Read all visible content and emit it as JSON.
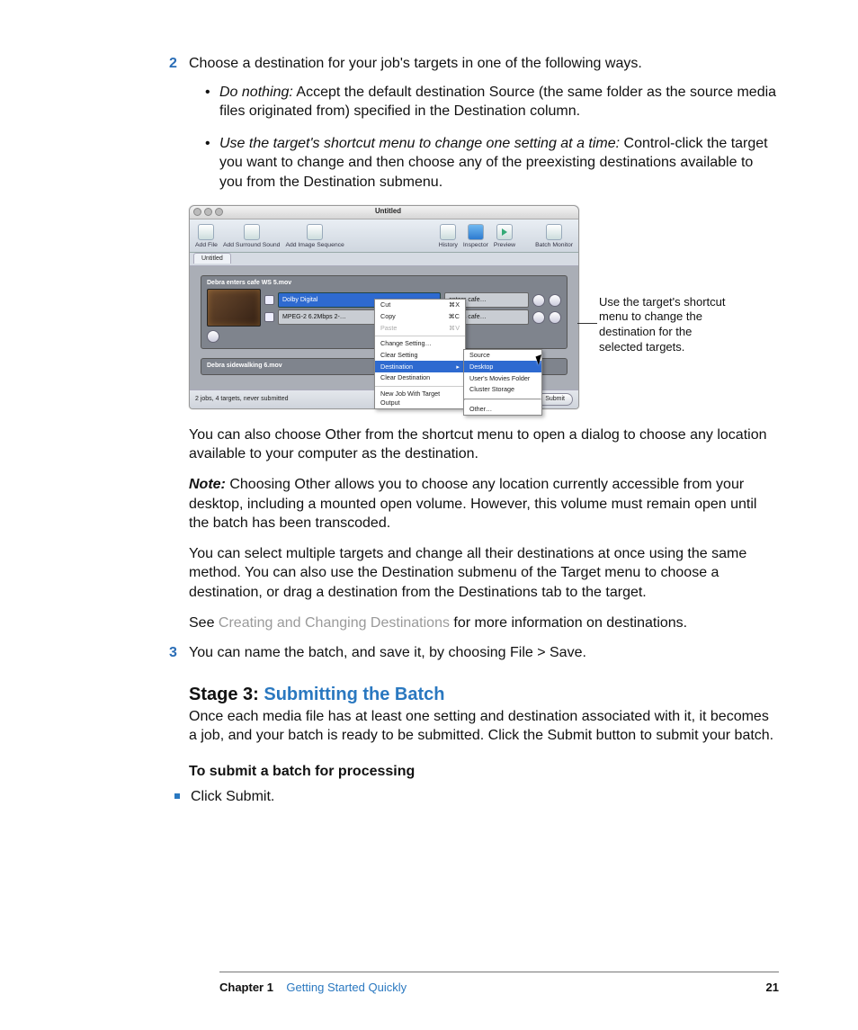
{
  "step2": {
    "num": "2",
    "text": "Choose a destination for your job's targets in one of the following ways.",
    "bullets": [
      {
        "lead": "Do nothing:",
        "rest": "  Accept the default destination Source (the same folder as the source media files originated from) specified in the Destination column."
      },
      {
        "lead": "Use the target's shortcut menu to change one setting at a time:",
        "rest": "  Control-click the target you want to change and then choose any of the preexisting destinations available to you from the Destination submenu."
      }
    ]
  },
  "screenshot": {
    "title": "Untitled",
    "toolbar": {
      "add_file": "Add File",
      "add_surround": "Add Surround Sound",
      "add_image_seq": "Add Image Sequence",
      "history": "History",
      "inspector": "Inspector",
      "preview": "Preview",
      "batch_monitor": "Batch Monitor"
    },
    "tab": "Untitled",
    "job1": {
      "title": "Debra enters cafe WS 5.mov",
      "row1_setting": "Dolby Digital",
      "row1_dest": "enters cafe…",
      "row2_setting": "MPEG-2 6.2Mbps 2-…",
      "row2_dest": "enters cafe…"
    },
    "job2": {
      "title": "Debra sidewalking 6.mov"
    },
    "menu": {
      "cut": "Cut",
      "cut_k": "⌘X",
      "copy": "Copy",
      "copy_k": "⌘C",
      "paste": "Paste",
      "paste_k": "⌘V",
      "change": "Change Setting…",
      "clear_s": "Clear Setting",
      "dest": "Destination",
      "clear_d": "Clear Destination",
      "newjob": "New Job With Target Output"
    },
    "submenu": {
      "source": "Source",
      "desktop": "Desktop",
      "movies": "User's Movies Folder",
      "cluster": "Cluster Storage",
      "other": "Other…"
    },
    "status": "2 jobs, 4 targets, never submitted",
    "submit": "Submit"
  },
  "callout": "Use the target's shortcut menu to change the destination for the selected targets.",
  "para_after": "You can also choose Other from the shortcut menu to open a dialog to choose any location available to your computer as the destination.",
  "note_lead": "Note:",
  "note_body": "  Choosing Other allows you to choose any location currently accessible from your desktop, including a mounted open volume. However, this volume must remain open until the batch has been transcoded.",
  "para_multi": "You can select multiple targets and change all their destinations at once using the same method. You can also use the Destination submenu of the Target menu to choose a destination, or drag a destination from the Destinations tab to the target.",
  "see_pre": "See ",
  "see_link": "Creating and Changing Destinations",
  "see_post": " for more information on destinations.",
  "step3": {
    "num": "3",
    "text": "You can name the batch, and save it, by choosing File > Save."
  },
  "stage": {
    "pre": "Stage 3: ",
    "link": "Submitting the Batch"
  },
  "stage_body": "Once each media file has at least one setting and destination associated with it, it becomes a job, and your batch is ready to be submitted. Click the Submit button to submit your batch.",
  "subhead": "To submit a batch for processing",
  "sq_item": "Click Submit.",
  "footer": {
    "chapter": "Chapter 1",
    "title": "Getting Started Quickly",
    "page": "21"
  }
}
